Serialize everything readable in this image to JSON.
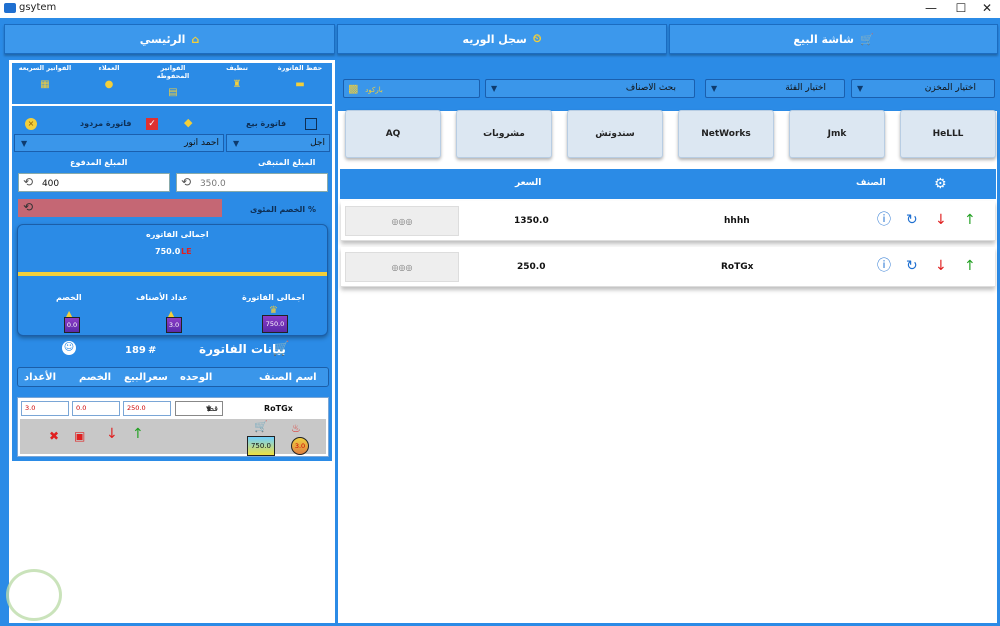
{
  "window": {
    "title": "gsytem",
    "minimize": "—",
    "maximize": "☐",
    "close": "✕"
  },
  "tabs": [
    {
      "label": "شاشة البيع",
      "icon": "🛒"
    },
    {
      "label": "سجل الوريه",
      "icon": "⏲"
    },
    {
      "label": "الرئيسي",
      "icon": "⌂"
    }
  ],
  "toolbar": [
    {
      "label": "حفظ الفاتورة",
      "icon": "▬"
    },
    {
      "label": "تنظيف",
      "icon": "♜"
    },
    {
      "label": "الفواتير المحفوظه",
      "icon": "▤"
    },
    {
      "label": "العملاء",
      "icon": "●"
    },
    {
      "label": "الفواتير السريعه",
      "icon": "▦"
    }
  ],
  "invoice": {
    "sale_invoice": "فاتورة بيع",
    "return_invoice": "فاتورة مردود",
    "payment_type": "اجل",
    "customer": "احمد انور",
    "remaining_label": "المبلغ المتبقى",
    "remaining_value": "350.0",
    "paid_label": "المبلغ المدفوع",
    "paid_value": "400",
    "discount_label": "الخصم المئوى %",
    "total_label": "اجمالى الفاتوره",
    "total_value": "750.0",
    "currency": "LE",
    "stats": [
      {
        "label": "اجمالى الفاتورة",
        "value": "750.0"
      },
      {
        "label": "عداد الأصناف",
        "value": "3.0"
      },
      {
        "label": "الخصم",
        "value": "0.0"
      }
    ],
    "data_title": "بيانات الفاتورة",
    "invoice_no_prefix": "#",
    "invoice_no": "189",
    "columns": [
      "اسم الصنف",
      "الوحده",
      "سعرالبيع",
      "الخصم",
      "الأعداد"
    ],
    "item": {
      "name": "RoTGx",
      "unit": "قط",
      "qty": "3.0",
      "discount": "0.0",
      "price": "250.0",
      "total": "750.0",
      "count_badge": "3.0"
    }
  },
  "filters": {
    "store": "اختيار المخزن",
    "category": "اختيار الفئة",
    "search": "بحث الاصناف",
    "barcode": "باركود"
  },
  "categories": [
    "HeLLL",
    "Jmk",
    "NetWorks",
    "سندوتش",
    "مشروبات",
    "AQ"
  ],
  "grid": {
    "col_item": "الصنف",
    "col_price": "السعر",
    "rows": [
      {
        "name": "hhhh",
        "price": "1350.0"
      },
      {
        "name": "RoTGx",
        "price": "250.0"
      }
    ]
  },
  "colors": {
    "primary": "#2b8be6",
    "accent": "#f3cf3a",
    "badge": "#6a2fb8",
    "discount_bar": "#c56774"
  }
}
